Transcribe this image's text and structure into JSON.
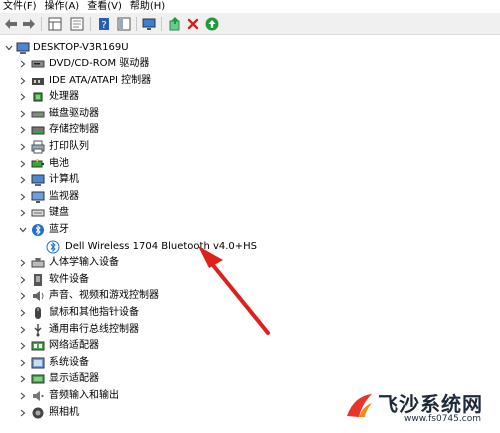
{
  "menu": [
    "文件(F)",
    "操作(A)",
    "查看(V)",
    "帮助(H)"
  ],
  "toolbar": {
    "back": "back-arrow-icon",
    "forward": "forward-arrow-icon",
    "view_list": "properties-grid-icon",
    "view_details": "document-icon",
    "help": "help-book-icon",
    "view_pane": "panel-icon",
    "monitor": "monitor-icon",
    "update_driver": "update-driver-icon",
    "uninstall": "red-x-icon",
    "scan": "green-circle-arrow-icon"
  },
  "tree": {
    "root": "DESKTOP-V3R169U",
    "categories": [
      {
        "label": "DVD/CD-ROM 驱动器",
        "icon": "dvd-drive-icon",
        "expanded": false
      },
      {
        "label": "IDE ATA/ATAPI 控制器",
        "icon": "ide-controller-icon",
        "expanded": false
      },
      {
        "label": "处理器",
        "icon": "processor-icon",
        "expanded": false
      },
      {
        "label": "磁盘驱动器",
        "icon": "disk-drive-icon",
        "expanded": false
      },
      {
        "label": "存储控制器",
        "icon": "storage-controller-icon",
        "expanded": false
      },
      {
        "label": "打印队列",
        "icon": "printer-icon",
        "expanded": false
      },
      {
        "label": "电池",
        "icon": "battery-icon",
        "expanded": false
      },
      {
        "label": "计算机",
        "icon": "computer-icon",
        "expanded": false
      },
      {
        "label": "监视器",
        "icon": "monitor-icon",
        "expanded": false
      },
      {
        "label": "键盘",
        "icon": "keyboard-icon",
        "expanded": false
      },
      {
        "label": "蓝牙",
        "icon": "bluetooth-icon",
        "expanded": true
      },
      {
        "label": "人体学输入设备",
        "icon": "hid-icon",
        "expanded": false
      },
      {
        "label": "软件设备",
        "icon": "software-device-icon",
        "expanded": false
      },
      {
        "label": "声音、视频和游戏控制器",
        "icon": "speaker-icon",
        "expanded": false
      },
      {
        "label": "鼠标和其他指针设备",
        "icon": "mouse-icon",
        "expanded": false
      },
      {
        "label": "通用串行总线控制器",
        "icon": "usb-icon",
        "expanded": false
      },
      {
        "label": "网络适配器",
        "icon": "network-adapter-icon",
        "expanded": false
      },
      {
        "label": "系统设备",
        "icon": "system-device-icon",
        "expanded": false
      },
      {
        "label": "显示适配器",
        "icon": "display-adapter-icon",
        "expanded": false
      },
      {
        "label": "音频输入和输出",
        "icon": "audio-io-icon",
        "expanded": false
      },
      {
        "label": "照相机",
        "icon": "camera-icon",
        "expanded": false
      }
    ],
    "bluetooth_child": "Dell Wireless 1704 Bluetooth v4.0+HS"
  },
  "watermark": {
    "title": "飞沙系统网",
    "url": "www.fs0745.com"
  },
  "colors": {
    "toolbar_bg": "#f0f0f0",
    "arrow_red": "#e0201b",
    "uninstall_red": "#d42121",
    "scan_green": "#1f9a3a",
    "bluetooth_blue": "#1f6fd1"
  }
}
